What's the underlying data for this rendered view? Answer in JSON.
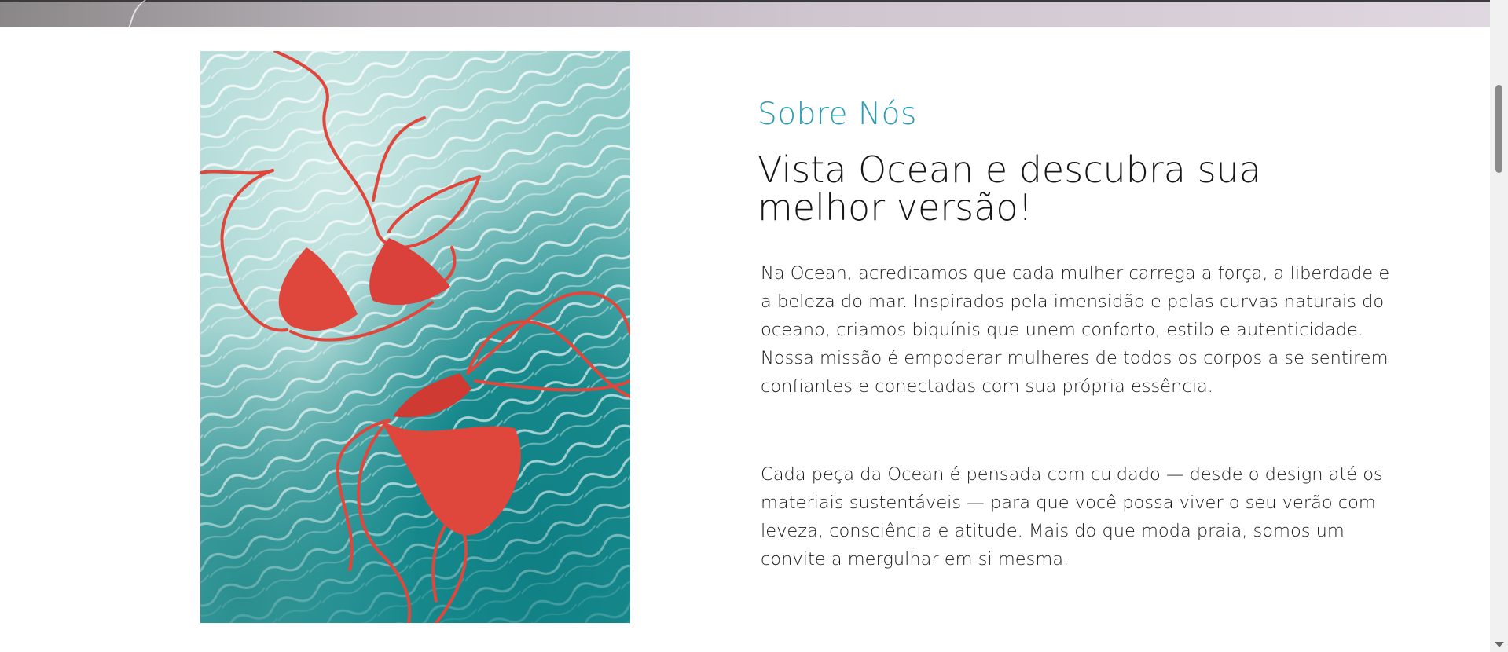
{
  "about": {
    "eyebrow": "Sobre Nós",
    "headline": "Vista Ocean e descubra sua melhor versão!",
    "paragraph_1": "Na Ocean, acreditamos que cada mulher carrega a força, a liberdade e a beleza do mar. Inspirados pela imensidão e pelas curvas naturais do oceano, criamos biquínis que unem conforto, estilo e autenticidade. Nossa missão é empoderar mulheres de todos os corpos a se sentirem confiantes e conectadas com sua própria essência.",
    "paragraph_2": "Cada peça da Ocean é pensada com cuidado — desde o design até os materiais sustentáveis — para que você possa viver o seu verão com leveza, consciência e atitude. Mais do que moda praia, somos um convite a mergulhar em si mesma."
  },
  "colors": {
    "accent": "#2a9db4",
    "text": "#151515",
    "bikini": "#e0473c",
    "water": "#16888c"
  },
  "photo": {
    "icon": "bikini-in-pool-photo"
  }
}
